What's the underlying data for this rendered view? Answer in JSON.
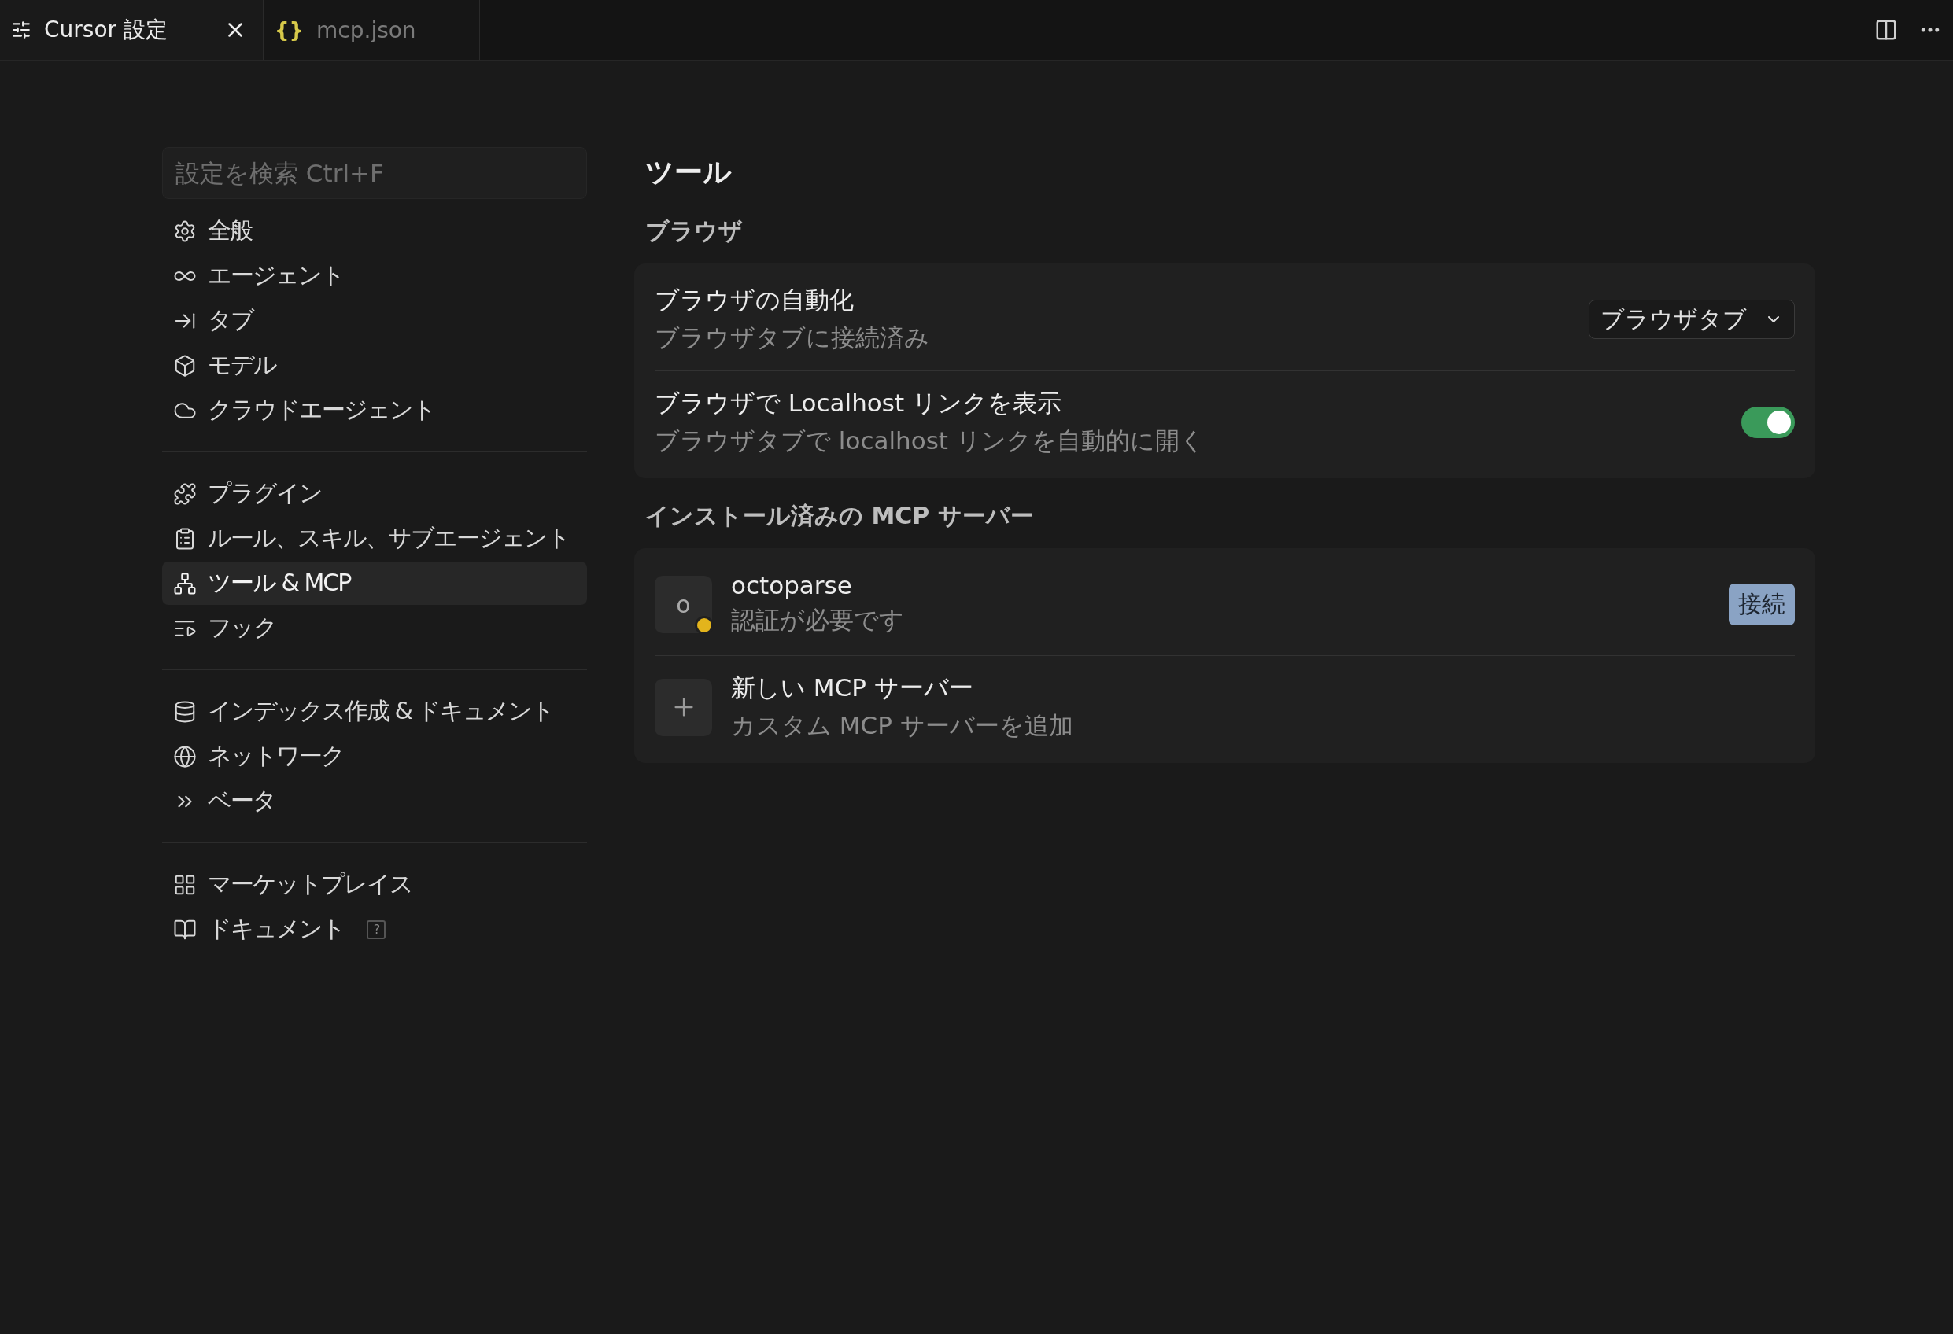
{
  "tabs": [
    {
      "label": "Cursor 設定",
      "selected": true
    },
    {
      "label": "mcp.json",
      "selected": false,
      "icon_text": "{}"
    }
  ],
  "sidebar": {
    "search": {
      "placeholder": "設定を検索 Ctrl+F"
    },
    "groups": [
      {
        "items": [
          {
            "label": "全般",
            "selected": false
          },
          {
            "label": "エージェント",
            "selected": false
          },
          {
            "label": "タブ",
            "selected": false
          },
          {
            "label": "モデル",
            "selected": false
          },
          {
            "label": "クラウドエージェント",
            "selected": false
          }
        ]
      },
      {
        "items": [
          {
            "label": "プラグイン",
            "selected": false
          },
          {
            "label": "ルール、スキル、サブエージェント",
            "selected": false
          },
          {
            "label": "ツール & MCP",
            "selected": true
          },
          {
            "label": "フック",
            "selected": false
          }
        ]
      },
      {
        "items": [
          {
            "label": "インデックス作成 & ドキュメント",
            "selected": false
          },
          {
            "label": "ネットワーク",
            "selected": false
          },
          {
            "label": "ベータ",
            "selected": false
          }
        ]
      },
      {
        "items": [
          {
            "label": "マーケットプレイス",
            "selected": false
          },
          {
            "label": "ドキュメント",
            "selected": false,
            "badge": "?"
          }
        ]
      }
    ]
  },
  "page": {
    "title": "ツール",
    "sections": [
      {
        "heading": "ブラウザ",
        "rows": [
          {
            "kind": "dropdown",
            "title": "ブラウザの自動化",
            "subtitle": "ブラウザタブに接続済み",
            "value": "ブラウザタブ"
          },
          {
            "kind": "toggle",
            "title": "ブラウザで Localhost リンクを表示",
            "subtitle": "ブラウザタブで localhost リンクを自動的に開く",
            "on": true
          }
        ]
      },
      {
        "heading": "インストール済みの MCP サーバー",
        "rows": [
          {
            "kind": "server",
            "avatar": "o",
            "title": "octoparse",
            "subtitle": "認証が必要です",
            "color": "#e3b41c",
            "button": "接続"
          },
          {
            "kind": "add",
            "title": "新しい MCP サーバー",
            "subtitle": "カスタム MCP サーバーを追加"
          }
        ]
      }
    ]
  }
}
